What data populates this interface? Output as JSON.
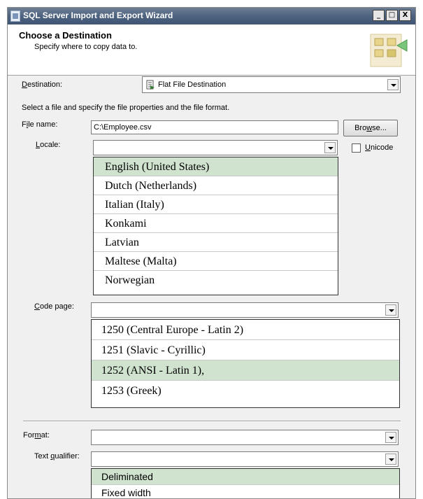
{
  "window": {
    "title": "SQL Server Import and Export Wizard",
    "buttons": {
      "minimize": "_",
      "maximize": "□",
      "close": "X"
    }
  },
  "header": {
    "title": "Choose a Destination",
    "subtitle": "Specify where to copy data to."
  },
  "destination": {
    "label_pre": "",
    "label_u": "D",
    "label_post": "estination:",
    "value": "Flat File Destination",
    "icon": "flat-file-icon"
  },
  "instructions": "Select a file and specify the file properties and the file format.",
  "file_name": {
    "label_pre": "F",
    "label_u": "i",
    "label_post": "le name:",
    "value": "C:\\Employee.csv",
    "browse_pre": "Bro",
    "browse_u": "w",
    "browse_post": "se..."
  },
  "locale": {
    "label_pre": "",
    "label_u": "L",
    "label_post": "ocale:",
    "value": "",
    "unicode_pre": "",
    "unicode_u": "U",
    "unicode_post": "nicode",
    "unicode_checked": false,
    "options": [
      "English (United States)",
      "Dutch (Netherlands)",
      "Italian (Italy)",
      "Konkami",
      "Latvian",
      "Maltese (Malta)",
      "Norwegian"
    ],
    "selected_index": 0
  },
  "code_page": {
    "label_pre": "",
    "label_u": "C",
    "label_post": "ode page:",
    "value": "",
    "options": [
      "1250 (Central Europe - Latin 2)",
      "1251 (Slavic - Cyrillic)",
      "1252 (ANSI - Latin 1),",
      "1253 (Greek)"
    ],
    "selected_index": 2
  },
  "format": {
    "label_pre": "For",
    "label_u": "m",
    "label_post": "at:",
    "value": ""
  },
  "text_qualifier": {
    "label_pre": "Text ",
    "label_u": "q",
    "label_post": "ualifier:",
    "value": "",
    "options": [
      "Deliminated",
      "Fixed width"
    ],
    "selected_index": 0
  },
  "colors": {
    "selected_item": "#cfe3cf",
    "titlebar": "#4e6380"
  }
}
